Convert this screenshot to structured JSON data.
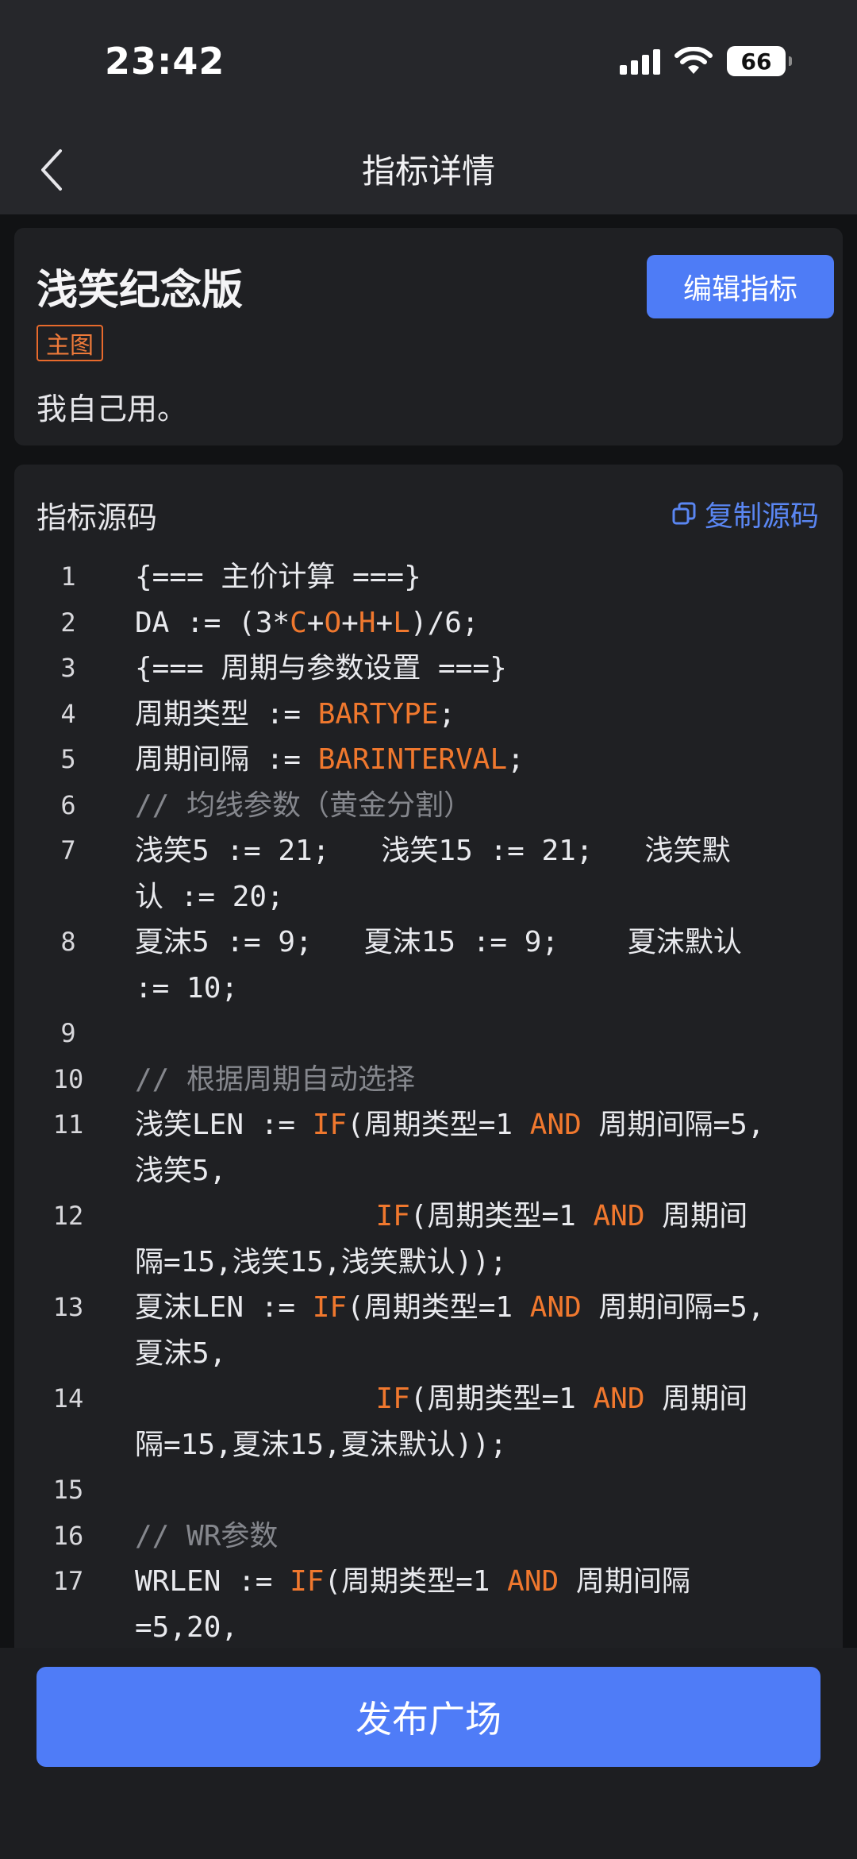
{
  "status": {
    "time": "23:42",
    "battery": "66"
  },
  "nav": {
    "title": "指标详情"
  },
  "indicator": {
    "title": "浅笑纪念版",
    "edit_label": "编辑指标",
    "tag": "主图",
    "description": "我自己用。"
  },
  "source": {
    "title": "指标源码",
    "copy_label": "复制源码",
    "lines": [
      {
        "n": "1",
        "rows": [
          "{=== 主价计算 ===}"
        ]
      },
      {
        "n": "2",
        "rows": [
          "DA := (3*C+O+H+L)/6;"
        ]
      },
      {
        "n": "3",
        "rows": [
          "{=== 周期与参数设置 ===}"
        ]
      },
      {
        "n": "4",
        "rows": [
          "周期类型 := BARTYPE;"
        ]
      },
      {
        "n": "5",
        "rows": [
          "周期间隔 := BARINTERVAL;"
        ]
      },
      {
        "n": "6",
        "rows": [
          "// 均线参数（黄金分割）"
        ]
      },
      {
        "n": "7",
        "rows": [
          "浅笑5 := 21;   浅笑15 := 21;   浅笑默",
          "认 := 20;"
        ]
      },
      {
        "n": "8",
        "rows": [
          "夏沫5 := 9;   夏沫15 := 9;    夏沫默认",
          ":= 10;"
        ]
      },
      {
        "n": "9",
        "rows": [
          ""
        ]
      },
      {
        "n": "10",
        "rows": [
          "// 根据周期自动选择"
        ]
      },
      {
        "n": "11",
        "rows": [
          "浅笑LEN := IF(周期类型=1 AND 周期间隔=5,",
          "浅笑5,"
        ]
      },
      {
        "n": "12",
        "rows": [
          "              IF(周期类型=1 AND 周期间",
          "隔=15,浅笑15,浅笑默认));"
        ]
      },
      {
        "n": "13",
        "rows": [
          "夏沫LEN := IF(周期类型=1 AND 周期间隔=5,",
          "夏沫5,"
        ]
      },
      {
        "n": "14",
        "rows": [
          "              IF(周期类型=1 AND 周期间",
          "隔=15,夏沫15,夏沫默认));"
        ]
      },
      {
        "n": "15",
        "rows": [
          ""
        ]
      },
      {
        "n": "16",
        "rows": [
          "// WR参数"
        ]
      },
      {
        "n": "17",
        "rows": [
          "WRLEN := IF(周期类型=1 AND 周期间隔",
          "=5,20,"
        ]
      }
    ]
  },
  "footer": {
    "publish_label": "发布广场"
  },
  "colors": {
    "accent": "#4f7cf7",
    "keyword": "#f0782e",
    "comment": "#85878d"
  }
}
